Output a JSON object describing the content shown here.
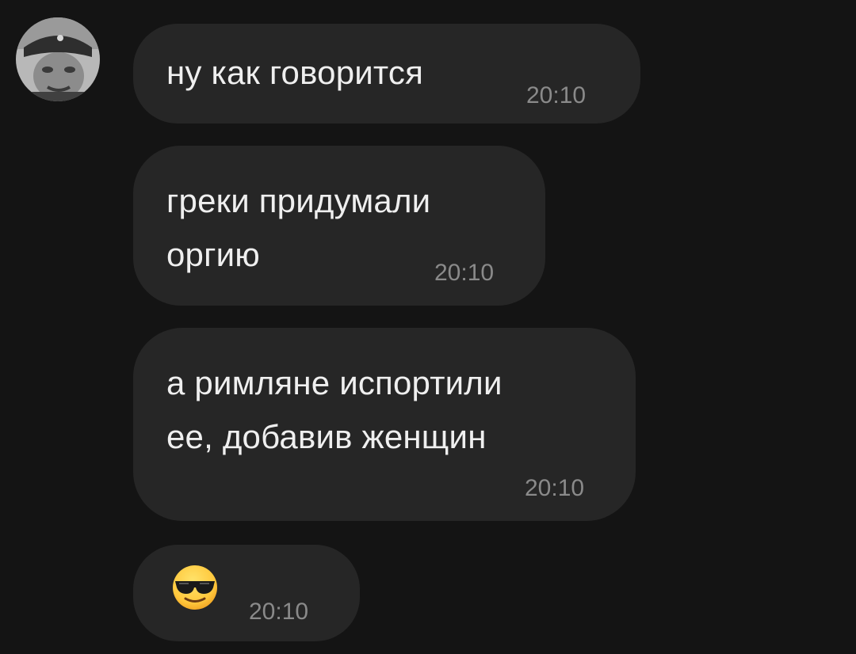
{
  "chat": {
    "avatar": {
      "icon": "contact-avatar-photo"
    },
    "messages": [
      {
        "text": "ну как говорится",
        "time": "20:10"
      },
      {
        "line1": "греки придумали",
        "line2": "оргию",
        "time": "20:10"
      },
      {
        "line1": "а римляне испортили",
        "line2": "ее, добавив женщин",
        "time": "20:10"
      },
      {
        "emoji": "smiling-face-with-sunglasses",
        "time": "20:10"
      }
    ]
  },
  "colors": {
    "background": "#141414",
    "bubble": "#262626",
    "text": "#efefef",
    "timestamp": "#8a8a8a"
  }
}
